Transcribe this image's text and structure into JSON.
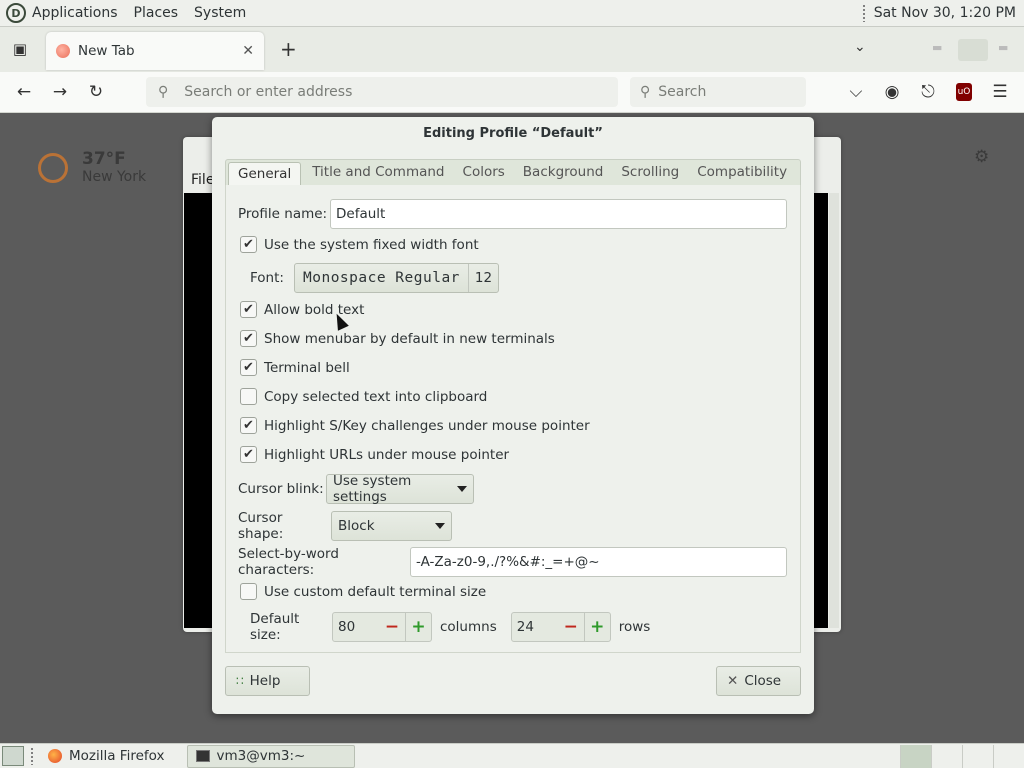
{
  "top_panel": {
    "menus": [
      "Applications",
      "Places",
      "System"
    ],
    "clock": "Sat Nov 30,  1:20 PM"
  },
  "browser": {
    "tab_title": "New Tab",
    "url_placeholder": "Search or enter address",
    "search_placeholder": "Search",
    "ublock_label": "uO"
  },
  "newtab_page": {
    "temperature": "37°F",
    "city": "New York"
  },
  "terminal_window": {
    "menu_file": "File"
  },
  "dialog": {
    "title": "Editing Profile “Default”",
    "tabs": [
      "General",
      "Title and Command",
      "Colors",
      "Background",
      "Scrolling",
      "Compatibility"
    ],
    "profile_name_label": "Profile name:",
    "profile_name_value": "Default",
    "checkboxes": [
      {
        "label": "Use the system fixed width font",
        "checked": true
      },
      {
        "label": "Allow bold text",
        "checked": true
      },
      {
        "label": "Show menubar by default in new terminals",
        "checked": true
      },
      {
        "label": "Terminal bell",
        "checked": true
      },
      {
        "label": "Copy selected text into clipboard",
        "checked": false
      },
      {
        "label": "Highlight S/Key challenges under mouse pointer",
        "checked": true
      },
      {
        "label": "Highlight URLs under mouse pointer",
        "checked": true
      },
      {
        "label": "Use custom default terminal size",
        "checked": false
      }
    ],
    "font_label": "Font:",
    "font_name": "Monospace Regular",
    "font_size": "12",
    "cursor_blink_label": "Cursor blink:",
    "cursor_blink_value": "Use system settings",
    "cursor_shape_label": "Cursor shape:",
    "cursor_shape_value": "Block",
    "select_by_word_label": "Select-by-word characters:",
    "select_by_word_value": "-A-Za-z0-9,./?%&#:_=+@~",
    "default_size_label": "Default size:",
    "columns_value": "80",
    "columns_label": "columns",
    "rows_value": "24",
    "rows_label": "rows",
    "help_label": "Help",
    "close_label": "Close"
  },
  "bottom_panel": {
    "tasks": [
      "Mozilla Firefox",
      "vm3@vm3:~"
    ]
  }
}
